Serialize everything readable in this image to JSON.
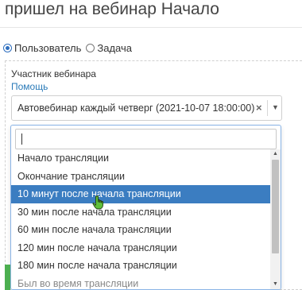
{
  "header": {
    "title": "пришел на вебинар Начало"
  },
  "radio_group": {
    "options": [
      {
        "label": "Пользователь",
        "checked": true
      },
      {
        "label": "Задача",
        "checked": false
      }
    ]
  },
  "field": {
    "label": "Участник вебинара",
    "help_link": "Помощь",
    "selected_value": "Автовебинар каждый четверг (2021-10-07 18:00:00)",
    "clear_symbol": "×",
    "caret_symbol": "▼"
  },
  "dropdown": {
    "search_value": "",
    "options": [
      {
        "label": "Начало трансляции",
        "highlighted": false
      },
      {
        "label": "Окончание трансляции",
        "highlighted": false
      },
      {
        "label": "10 минут после начала трансляции",
        "highlighted": true
      },
      {
        "label": "30 мин после начала трансляции",
        "highlighted": false
      },
      {
        "label": "60 мин после начала трансляции",
        "highlighted": false
      },
      {
        "label": "120 мин после начала трансляции",
        "highlighted": false
      },
      {
        "label": "180 мин после начала трансляции",
        "highlighted": false
      },
      {
        "label": "Был во время трансляции",
        "highlighted": false
      }
    ]
  },
  "colors": {
    "accent": "#3b7dc1",
    "link": "#2a7ab8",
    "green": "#4caf50"
  },
  "icons": {
    "cursor": "hand-pointer-icon"
  }
}
